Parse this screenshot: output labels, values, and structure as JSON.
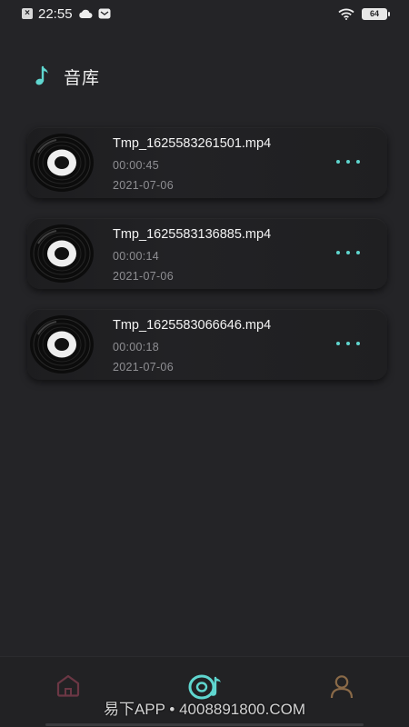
{
  "status_bar": {
    "time": "22:55",
    "battery": "64"
  },
  "header": {
    "title": "音库",
    "icon": "music-note-icon",
    "accent": "#5fd6cf"
  },
  "tracks": [
    {
      "title": "Tmp_1625583261501.mp4",
      "duration": "00:00:45",
      "date": "2021-07-06"
    },
    {
      "title": "Tmp_1625583136885.mp4",
      "duration": "00:00:14",
      "date": "2021-07-06"
    },
    {
      "title": "Tmp_1625583066646.mp4",
      "duration": "00:00:18",
      "date": "2021-07-06"
    }
  ],
  "bottom_nav": {
    "items": [
      "home-icon",
      "music-disc-icon",
      "profile-icon"
    ],
    "active_index": 1
  },
  "watermark": "易下APP • 4008891800.COM"
}
